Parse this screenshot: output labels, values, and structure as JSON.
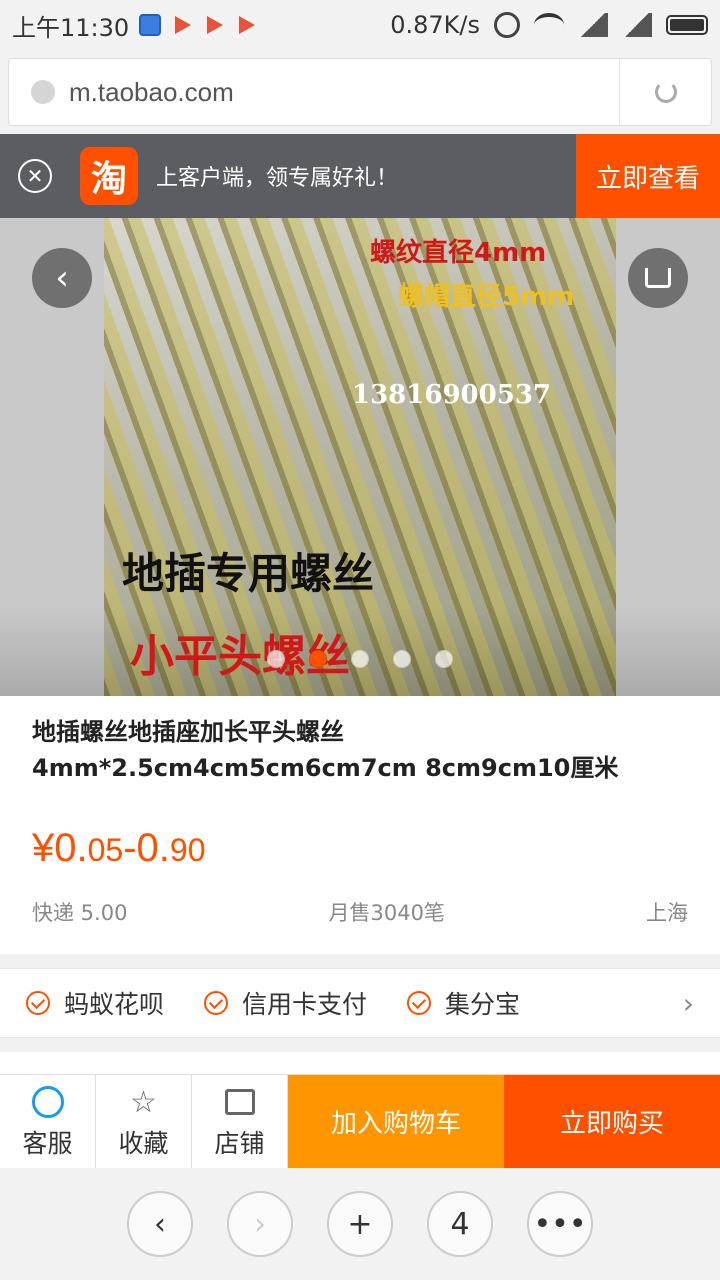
{
  "status_bar": {
    "time": "上午11:30",
    "net_speed": "0.87K/s",
    "network": "3G\n1X"
  },
  "address_bar": {
    "url": "m.taobao.com"
  },
  "app_banner": {
    "logo_char": "淘",
    "text": "上客户端，领专属好礼！",
    "cta": "立即查看"
  },
  "gallery": {
    "overlay_text": {
      "thread_diameter": "螺纹直径4mm",
      "head_diameter": "螺帽直径5mm",
      "phone": "13816900537",
      "headline": "地插专用螺丝",
      "subline": "小平头螺丝"
    },
    "dots_count": 5,
    "active_dot": 1
  },
  "product": {
    "title_line1": "地插螺丝地插座加长平头螺丝",
    "title_line2": "4mm*2.5cm4cm5cm6cm7cm 8cm9cm10厘米",
    "price_parts": [
      "¥0.",
      "05",
      "-0.",
      "90"
    ],
    "shipping": "快递 5.00",
    "monthly_sales": "月售3040笔",
    "location": "上海"
  },
  "services": {
    "items": [
      "蚂蚁花呗",
      "信用卡支付",
      "集分宝"
    ]
  },
  "action_bar": {
    "customer_service": "客服",
    "favorite": "收藏",
    "shop": "店铺",
    "add_to_cart": "加入购物车",
    "buy_now": "立即购买"
  },
  "browser_nav": {
    "tab_count": "4"
  },
  "colors": {
    "accent": "#ff5000",
    "cart_button": "#ff9500",
    "banner_bg": "#5a5d62"
  }
}
